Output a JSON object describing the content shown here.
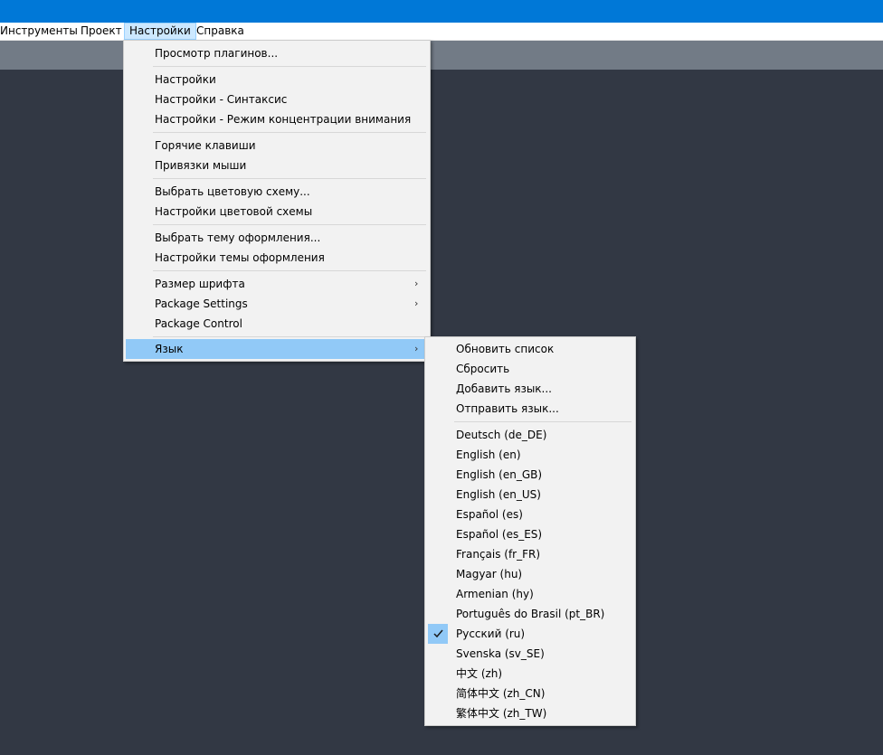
{
  "menubar": {
    "items": [
      {
        "label": "Инструменты"
      },
      {
        "label": "Проект"
      },
      {
        "label": "Настройки"
      },
      {
        "label": "Справка"
      }
    ]
  },
  "settings_menu": {
    "items": [
      {
        "label": "Просмотр плагинов..."
      },
      {
        "label": "Настройки"
      },
      {
        "label": "Настройки - Синтаксис"
      },
      {
        "label": "Настройки - Режим концентрации внимания"
      },
      {
        "label": "Горячие клавиши"
      },
      {
        "label": "Привязки мыши"
      },
      {
        "label": "Выбрать цветовую схему..."
      },
      {
        "label": "Настройки цветовой схемы"
      },
      {
        "label": "Выбрать тему оформления..."
      },
      {
        "label": "Настройки темы оформления"
      },
      {
        "label": "Размер шрифта",
        "submenu_icon": "chevron-right-icon"
      },
      {
        "label": "Package Settings",
        "submenu_icon": "chevron-right-icon"
      },
      {
        "label": "Package Control"
      },
      {
        "label": "Язык",
        "submenu_icon": "chevron-right-icon"
      }
    ]
  },
  "language_menu": {
    "items": [
      {
        "label": "Обновить список"
      },
      {
        "label": "Сбросить"
      },
      {
        "label": "Добавить язык..."
      },
      {
        "label": "Отправить язык..."
      },
      {
        "label": "Deutsch (de_DE)"
      },
      {
        "label": "English (en)"
      },
      {
        "label": "English (en_GB)"
      },
      {
        "label": "English (en_US)"
      },
      {
        "label": "Español (es)"
      },
      {
        "label": "Español (es_ES)"
      },
      {
        "label": "Français (fr_FR)"
      },
      {
        "label": "Magyar (hu)"
      },
      {
        "label": "Armenian (hy)"
      },
      {
        "label": "Português do Brasil (pt_BR)"
      },
      {
        "label": "Русский (ru)",
        "checked": true,
        "check_icon": "checkmark-icon"
      },
      {
        "label": "Svenska (sv_SE)"
      },
      {
        "label": "中文 (zh)"
      },
      {
        "label": "简体中文 (zh_CN)"
      },
      {
        "label": "繁体中文 (zh_TW)"
      }
    ]
  },
  "colors": {
    "titlebar": "#0078d7",
    "editor_background": "#323844",
    "tab_strip": "#727b86",
    "menu_background": "#f2f2f2",
    "highlight": "#91c9f7",
    "menubar_active": "#cce8ff"
  }
}
